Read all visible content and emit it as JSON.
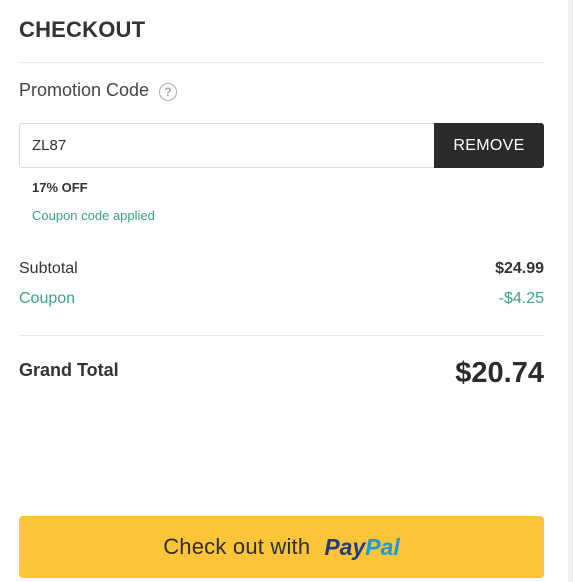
{
  "checkout": {
    "title": "CHECKOUT"
  },
  "promo": {
    "label": "Promotion Code",
    "help_icon": "question-circle-icon",
    "code_value": "ZL87",
    "remove_label": "REMOVE",
    "discount_text": "17% OFF",
    "status_text": "Coupon code applied"
  },
  "summary": {
    "subtotal_label": "Subtotal",
    "subtotal_value": "$24.99",
    "coupon_label": "Coupon",
    "coupon_value": "-$4.25",
    "grand_total_label": "Grand Total",
    "grand_total_value": "$20.74"
  },
  "paypal": {
    "text": "Check out with",
    "logo_pay": "Pay",
    "logo_pal": "Pal"
  },
  "colors": {
    "accent_green": "#3aa38a",
    "button_dark": "#2b2b2b",
    "paypal_yellow": "#ffc439",
    "paypal_dark_blue": "#253b80",
    "paypal_light_blue": "#179bd7"
  }
}
